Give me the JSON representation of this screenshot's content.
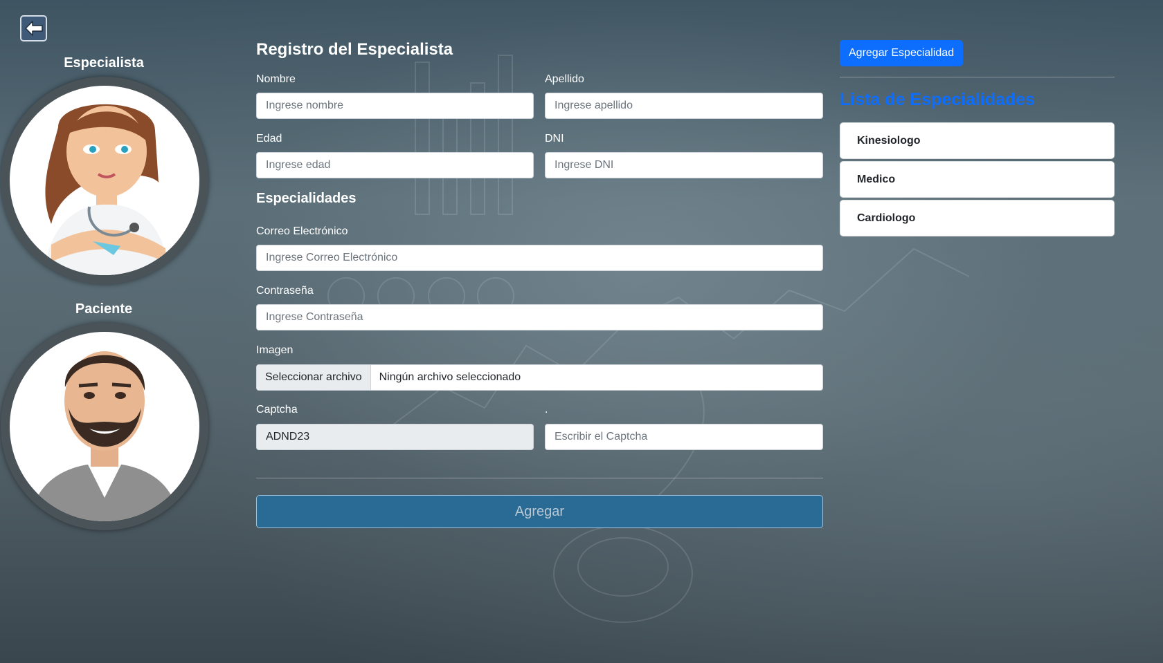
{
  "nav": {
    "back_icon": "arrow-left-icon"
  },
  "profiles": {
    "specialist_label": "Especialista",
    "patient_label": "Paciente"
  },
  "form": {
    "title": "Registro del Especialista",
    "nombre": {
      "label": "Nombre",
      "placeholder": "Ingrese nombre",
      "value": ""
    },
    "apellido": {
      "label": "Apellido",
      "placeholder": "Ingrese apellido",
      "value": ""
    },
    "edad": {
      "label": "Edad",
      "placeholder": "Ingrese edad",
      "value": ""
    },
    "dni": {
      "label": "DNI",
      "placeholder": "Ingrese DNI",
      "value": ""
    },
    "especialidades_title": "Especialidades",
    "correo": {
      "label": "Correo Electrónico",
      "placeholder": "Ingrese Correo Electrónico",
      "value": ""
    },
    "contrasena": {
      "label": "Contraseña",
      "placeholder": "Ingrese Contraseña",
      "value": ""
    },
    "imagen": {
      "label": "Imagen",
      "button": "Seleccionar archivo",
      "status": "Ningún archivo seleccionado"
    },
    "captcha": {
      "label": "Captcha",
      "code": "ADND23",
      "second_label": ".",
      "placeholder": "Escribir el Captcha",
      "value": ""
    },
    "submit_label": "Agregar"
  },
  "specialties_panel": {
    "add_button": "Agregar Especialidad",
    "title": "Lista de Especialidades",
    "items": [
      "Kinesiologo",
      "Medico",
      "Cardiologo"
    ]
  },
  "colors": {
    "primary": "#0d6efd",
    "submit_bg": "#2a6b95",
    "back_button_bg": "#3e5a78"
  }
}
